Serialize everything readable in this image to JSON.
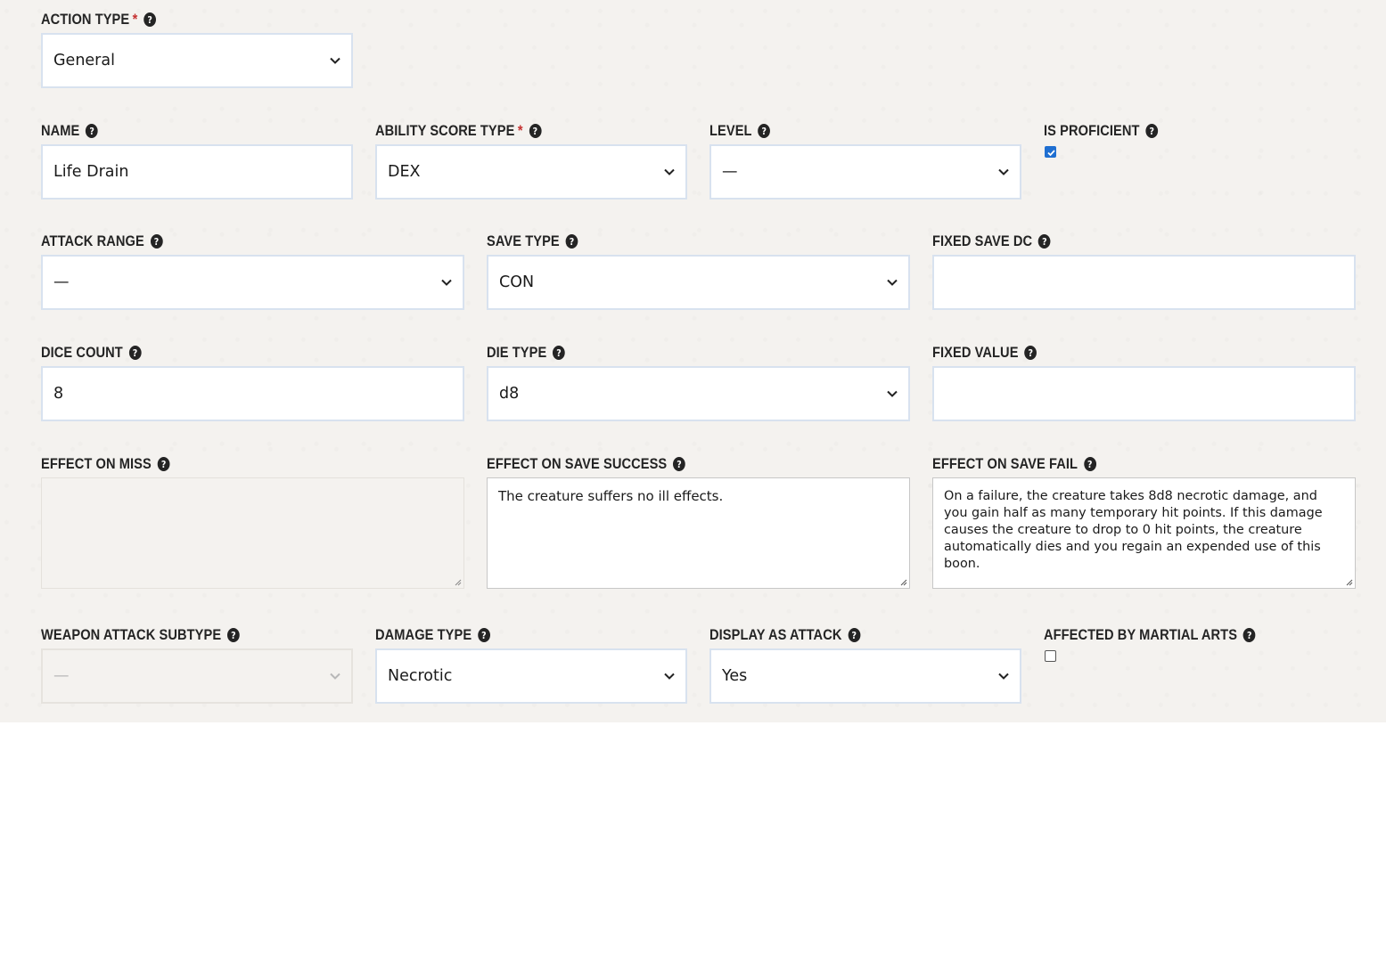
{
  "form": {
    "action_type": {
      "label": "ACTION TYPE",
      "required": "*",
      "value": "General"
    },
    "name": {
      "label": "NAME",
      "value": "Life Drain"
    },
    "ability_score_type": {
      "label": "ABILITY SCORE TYPE",
      "required": "*",
      "value": "DEX"
    },
    "level": {
      "label": "LEVEL",
      "value": "—"
    },
    "is_proficient": {
      "label": "IS PROFICIENT",
      "checked": true
    },
    "attack_range": {
      "label": "ATTACK RANGE",
      "value": "—"
    },
    "save_type": {
      "label": "SAVE TYPE",
      "value": "CON"
    },
    "fixed_save_dc": {
      "label": "FIXED SAVE DC",
      "value": ""
    },
    "dice_count": {
      "label": "DICE COUNT",
      "value": "8"
    },
    "die_type": {
      "label": "DIE TYPE",
      "value": "d8"
    },
    "fixed_value": {
      "label": "FIXED VALUE",
      "value": ""
    },
    "effect_on_miss": {
      "label": "EFFECT ON MISS",
      "value": ""
    },
    "effect_on_save_success": {
      "label": "EFFECT ON SAVE SUCCESS",
      "value": "The creature suffers no ill effects."
    },
    "effect_on_save_fail": {
      "label": "EFFECT ON SAVE FAIL",
      "value": "On a failure, the creature takes 8d8 necrotic damage, and you gain half as many temporary hit points. If this damage causes the creature to drop to 0 hit points, the creature automatically dies and you regain an expended use of this boon."
    },
    "weapon_attack_subtype": {
      "label": "WEAPON ATTACK SUBTYPE",
      "value": "—",
      "disabled": true
    },
    "damage_type": {
      "label": "DAMAGE TYPE",
      "value": "Necrotic"
    },
    "display_as_attack": {
      "label": "DISPLAY AS ATTACK",
      "value": "Yes"
    },
    "affected_by_martial_arts": {
      "label": "AFFECTED BY MARTIAL ARTS",
      "checked": false
    }
  },
  "icons": {
    "help": "question-circle-icon",
    "dropdown": "chevron-down-icon",
    "resize": "resize-grip-icon"
  },
  "help_glyph": "?",
  "colors": {
    "required": "#c53131",
    "checkbox_checked": "#1f6fd1",
    "label": "#242424",
    "input_border": "#d8e2ef"
  }
}
